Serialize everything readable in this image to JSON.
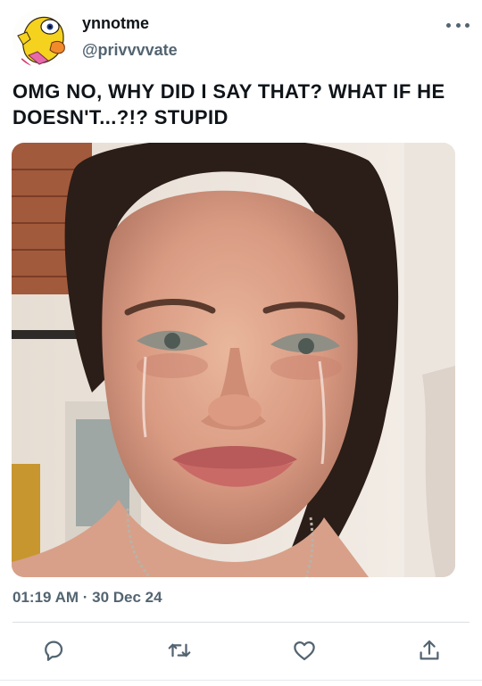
{
  "tweet": {
    "display_name": "ynnotme",
    "handle": "@privvvvate",
    "text": "OMG NO, WHY DID I SAY THAT? WHAT IF HE DOESN'T...?!? STUPID",
    "timestamp": "01:19 AM · 30 Dec 24",
    "media": {
      "description_icon": "photo-of-crying-woman"
    }
  },
  "icons": {
    "more": "more-options-icon",
    "reply": "reply-icon",
    "retweet": "retweet-icon",
    "like": "like-icon",
    "share": "share-icon"
  },
  "colors": {
    "text_primary": "#0f1419",
    "text_secondary": "#536471",
    "icon": "#536471",
    "divider": "#dcdfe2"
  }
}
